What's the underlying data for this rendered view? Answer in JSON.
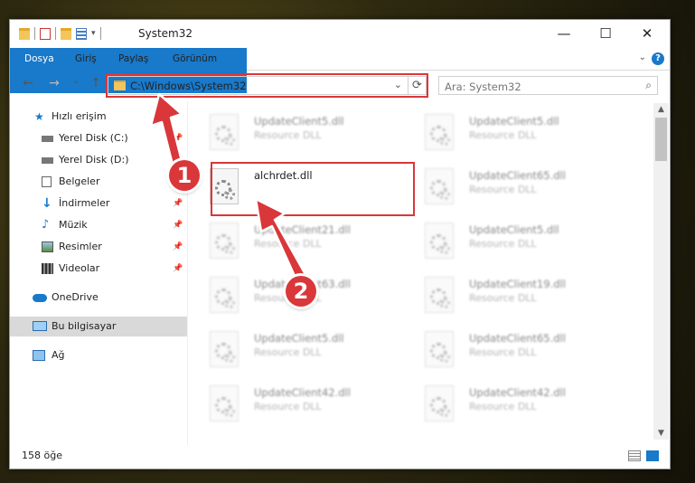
{
  "window": {
    "title": "System32",
    "controls": {
      "minimize": "—",
      "maximize": "☐",
      "close": "✕"
    }
  },
  "ribbon": {
    "tabs": [
      "Dosya",
      "Giriş",
      "Paylaş",
      "Görünüm"
    ],
    "help": "?"
  },
  "nav": {
    "back": "←",
    "forward": "→",
    "recent": "⌄",
    "up": "↑",
    "address": "C:\\Windows\\System32",
    "address_dropdown": "⌄",
    "refresh": "⟳",
    "search_placeholder": "Ara: System32",
    "search_icon": "⌕"
  },
  "sidebar": {
    "items": [
      {
        "label": "Hızlı erişim",
        "icon": "star-icon"
      },
      {
        "label": "Yerel Disk (C:)",
        "icon": "drive-icon",
        "pinned": true
      },
      {
        "label": "Yerel Disk (D:)",
        "icon": "drive-icon",
        "pinned": true
      },
      {
        "label": "Belgeler",
        "icon": "documents-icon",
        "pinned": true
      },
      {
        "label": "İndirmeler",
        "icon": "download-icon",
        "pinned": true
      },
      {
        "label": "Müzik",
        "icon": "music-icon",
        "pinned": true
      },
      {
        "label": "Resimler",
        "icon": "pictures-icon",
        "pinned": true
      },
      {
        "label": "Videolar",
        "icon": "videos-icon",
        "pinned": true
      },
      {
        "label": "OneDrive",
        "icon": "cloud-icon"
      },
      {
        "label": "Bu bilgisayar",
        "icon": "computer-icon",
        "selected": true
      },
      {
        "label": "Ağ",
        "icon": "network-icon"
      }
    ]
  },
  "files": [
    {
      "name": "UpdateClient5.dll",
      "type": "Resource DLL"
    },
    {
      "name": "UpdateClient5.dll",
      "type": "Resource DLL"
    },
    {
      "name": "alchrdet.dll",
      "type": ""
    },
    {
      "name": "UpdateClient65.dll",
      "type": "Resource DLL"
    },
    {
      "name": "UpdateClient21.dll",
      "type": "Resource DLL"
    },
    {
      "name": "UpdateClient5.dll",
      "type": "Resource DLL"
    },
    {
      "name": "UpdateClient63.dll",
      "type": "Resource DLL"
    },
    {
      "name": "UpdateClient19.dll",
      "type": "Resource DLL"
    },
    {
      "name": "UpdateClient5.dll",
      "type": "Resource DLL"
    },
    {
      "name": "UpdateClient65.dll",
      "type": "Resource DLL"
    },
    {
      "name": "UpdateClient42.dll",
      "type": "Resource DLL"
    },
    {
      "name": "UpdateClient42.dll",
      "type": "Resource DLL"
    }
  ],
  "status": {
    "count": "158 öğe"
  },
  "callouts": [
    "1",
    "2"
  ],
  "colors": {
    "accent": "#1979ca",
    "highlight": "#d9373a",
    "selected": "#d9d9d9"
  }
}
